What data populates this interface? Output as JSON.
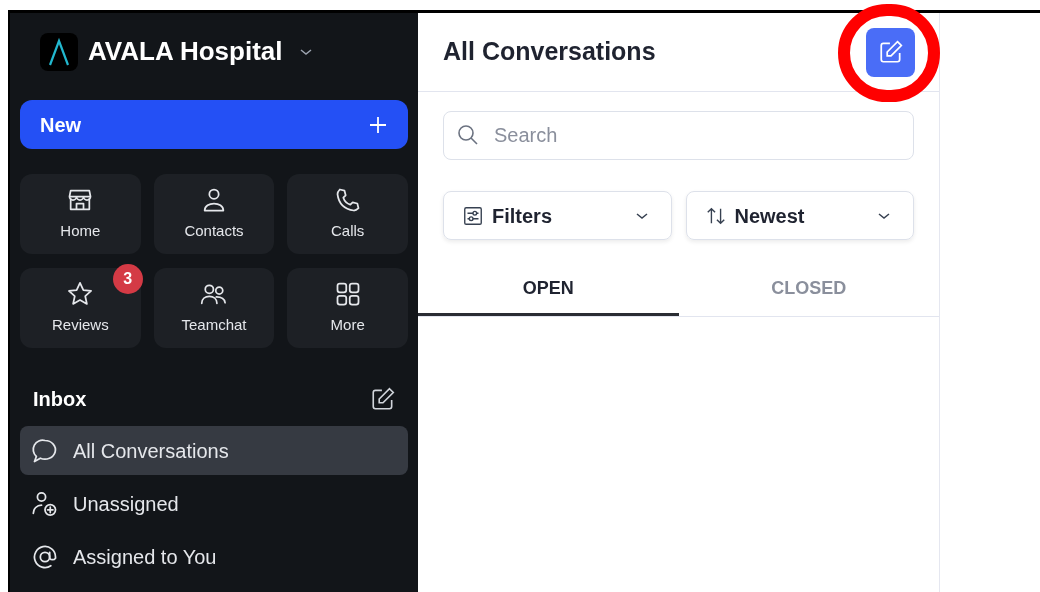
{
  "workspace": {
    "name": "AVALA Hospital"
  },
  "new_button": {
    "label": "New"
  },
  "tiles": [
    {
      "kind": "store",
      "label": "Home"
    },
    {
      "kind": "person",
      "label": "Contacts"
    },
    {
      "kind": "phone",
      "label": "Calls"
    },
    {
      "kind": "star",
      "label": "Reviews",
      "badge": "3"
    },
    {
      "kind": "people",
      "label": "Teamchat"
    },
    {
      "kind": "grid",
      "label": "More"
    }
  ],
  "inbox": {
    "title": "Inbox",
    "items": [
      {
        "kind": "chat",
        "label": "All Conversations",
        "selected": true
      },
      {
        "kind": "person-add",
        "label": "Unassigned",
        "selected": false
      },
      {
        "kind": "at",
        "label": "Assigned to You",
        "selected": false
      }
    ]
  },
  "main": {
    "title": "All Conversations",
    "search": {
      "placeholder": "Search"
    },
    "dropdowns": [
      {
        "kind": "filter",
        "label": "Filters"
      },
      {
        "kind": "sort",
        "label": "Newest"
      }
    ],
    "tabs": [
      {
        "label": "OPEN",
        "selected": true
      },
      {
        "label": "CLOSED",
        "selected": false
      }
    ]
  }
}
